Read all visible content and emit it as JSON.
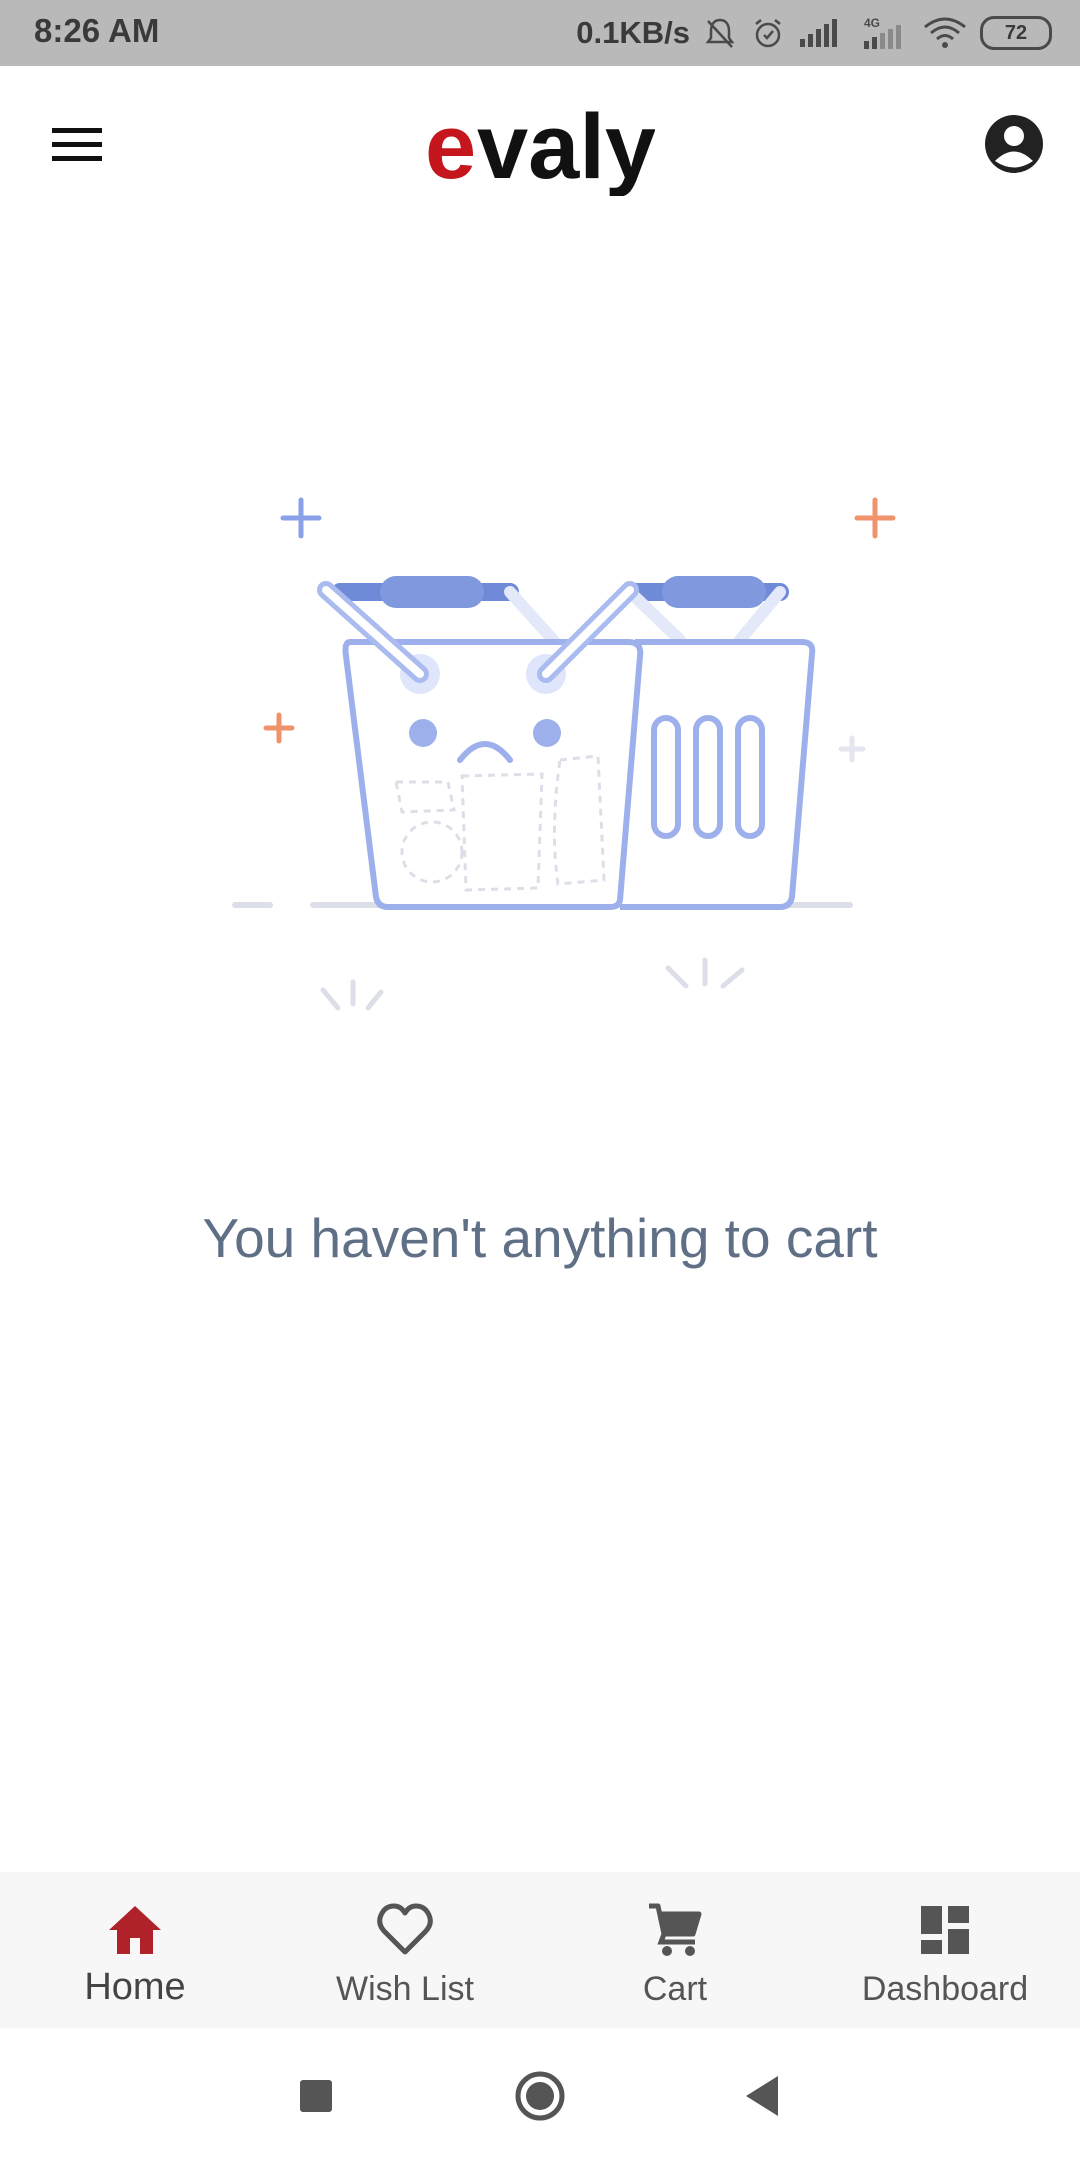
{
  "status_bar": {
    "time": "8:26 AM",
    "network_speed": "0.1KB/s",
    "battery_level": "72",
    "icons": [
      "mute-icon",
      "alarm-icon",
      "signal-icon",
      "signal-4g-icon",
      "wifi-icon",
      "battery-icon"
    ]
  },
  "app_bar": {
    "brand": "evaly",
    "brand_colors": {
      "e": "#c4161c",
      "rest": "#111111"
    },
    "menu_icon": "hamburger-menu-icon",
    "profile_icon": "account-circle-icon"
  },
  "empty_state": {
    "illustration": "sad-shopping-basket",
    "message": "You haven't anything to cart"
  },
  "bottom_nav": {
    "active": "Home",
    "active_color": "#b0222a",
    "items": [
      {
        "label": "Home",
        "icon": "home-icon"
      },
      {
        "label": "Wish List",
        "icon": "heart-icon"
      },
      {
        "label": "Cart",
        "icon": "cart-icon"
      },
      {
        "label": "Dashboard",
        "icon": "dashboard-icon"
      }
    ]
  },
  "system_nav": {
    "icons": [
      "recents-icon",
      "home-circle-icon",
      "back-icon"
    ]
  }
}
